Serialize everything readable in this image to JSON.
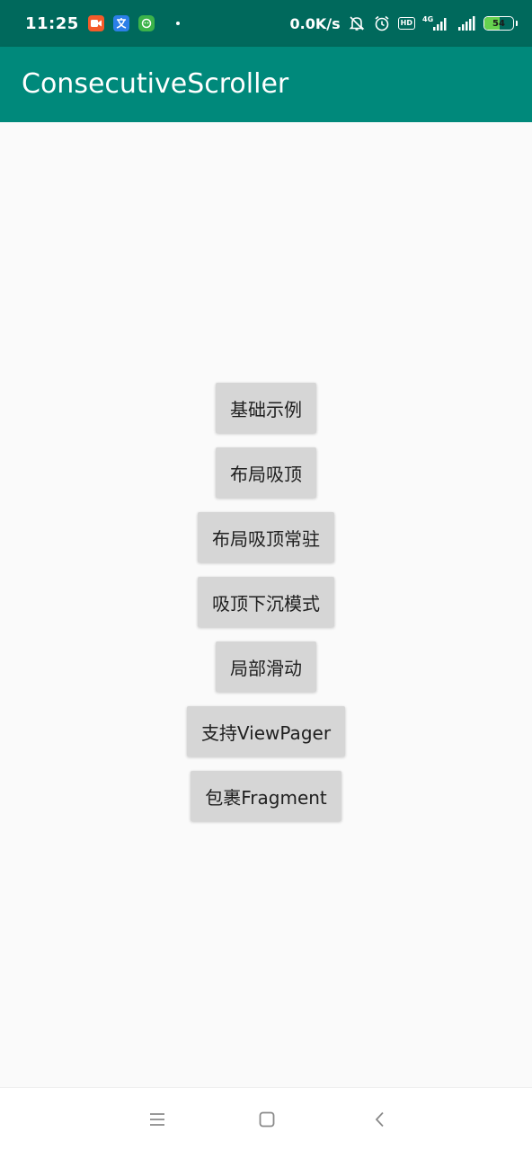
{
  "status_bar": {
    "time": "11:25",
    "net_speed": "0.0K/s",
    "hd_label": "HD",
    "signal_label": "4G",
    "battery_level": "54",
    "battery_percent": 54,
    "background_color": "#00695c",
    "icons": [
      "video-app-icon",
      "translate-app-icon",
      "wechat-app-icon",
      "notification-dot",
      "mute-icon",
      "alarm-icon",
      "hd-icon",
      "signal-4g-icon",
      "wifi-signal-icon",
      "battery-icon"
    ]
  },
  "app_bar": {
    "title": "ConsecutiveScroller",
    "background_color": "#00897b"
  },
  "main": {
    "buttons": [
      {
        "label": "基础示例"
      },
      {
        "label": "布局吸顶"
      },
      {
        "label": "布局吸顶常驻"
      },
      {
        "label": "吸顶下沉模式"
      },
      {
        "label": "局部滑动"
      },
      {
        "label": "支持ViewPager"
      },
      {
        "label": "包裹Fragment"
      }
    ]
  },
  "nav_bar": {
    "items": [
      "menu-icon",
      "home-icon",
      "back-icon"
    ]
  }
}
